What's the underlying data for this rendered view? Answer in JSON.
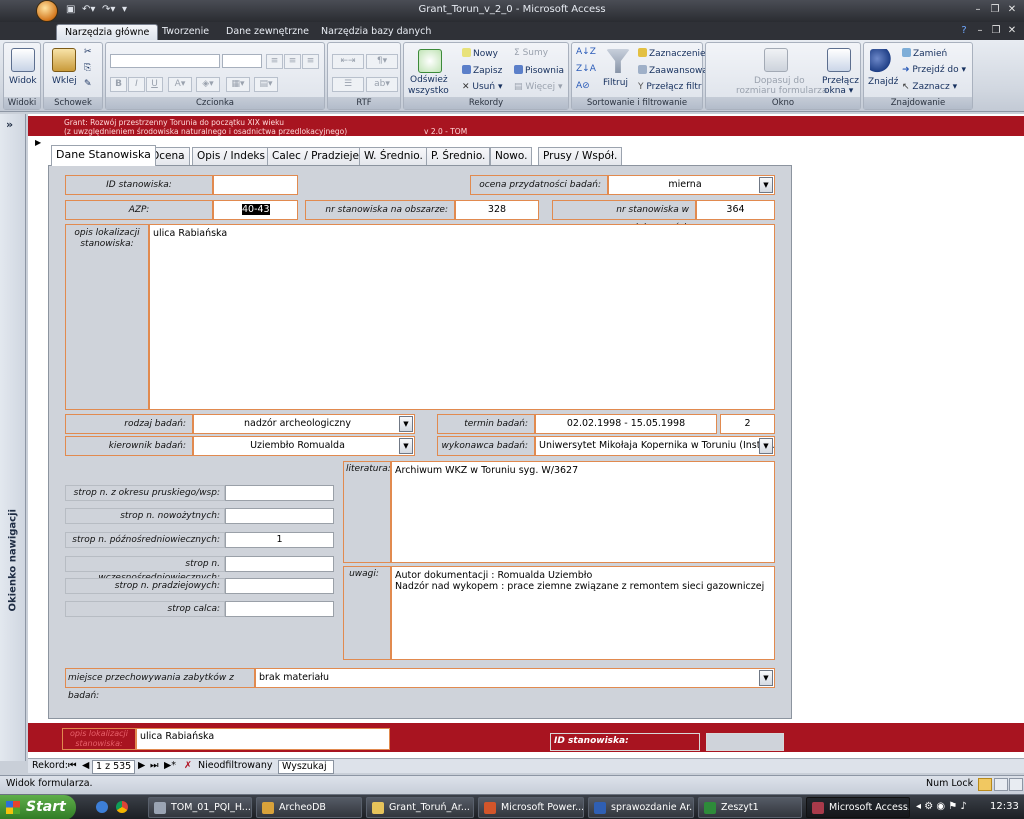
{
  "window": {
    "title": "Grant_Torun_v_2_0 - Microsoft Access"
  },
  "ribbon_tabs": [
    "Narzędzia główne",
    "Tworzenie",
    "Dane zewnętrzne",
    "Narzędzia bazy danych"
  ],
  "ribbon": {
    "widok": "Widok",
    "wklej": "Wklej",
    "groups": {
      "widoki": "Widoki",
      "schowek": "Schowek",
      "czcionka": "Czcionka",
      "rtf": "RTF",
      "rekordy": "Rekordy",
      "sort": "Sortowanie i filtrowanie",
      "okno": "Okno",
      "znajdowanie": "Znajdowanie"
    },
    "odswiez": "Odśwież",
    "wszystko": "wszystko",
    "nowy": "Nowy",
    "zapisz": "Zapisz",
    "usun": "Usuń",
    "sumy": "Sumy",
    "pisownia": "Pisownia",
    "wiecej": "Więcej",
    "filtruj": "Filtruj",
    "zaznaczenie": "Zaznaczenie",
    "zaawansowane": "Zaawansowane",
    "przelacz_filtr": "Przełącz filtr",
    "dopasuj1": "Dopasuj do",
    "dopasuj2": "rozmiaru formularza",
    "przelacz1": "Przełącz",
    "przelacz2": "okna",
    "znajdz": "Znajdź",
    "zamien": "Zamień",
    "przejdz": "Przejdź do",
    "zaznacz": "Zaznacz"
  },
  "nav_pane": {
    "title": "Okienko nawigacji"
  },
  "header": {
    "line1": "Grant: Rozwój przestrzenny Torunia do początku XIX wieku",
    "line2": "(z uwzględnieniem środowiska naturalnego i osadnictwa przedlokacyjnego)",
    "version": "v 2.0 - TOM"
  },
  "form_tabs": [
    "Dane Stanowiska",
    "Ocena",
    "Opis / Indeks",
    "Calec / Pradzieje",
    "W. Średnio.",
    "P. Średnio.",
    "Nowo.",
    "Prusy / Współ."
  ],
  "fields": {
    "id_label": "ID stanowiska:",
    "id_value": "",
    "ocena_label": "ocena przydatności badań:",
    "ocena_value": "mierna",
    "azp_label": "AZP:",
    "azp_value": "40-43",
    "nr_obszar_label": "nr stanowiska na obszarze:",
    "nr_obszar_value": "328",
    "nr_miejsc_label": "nr stanowiska w miejscowości:",
    "nr_miejsc_value": "364",
    "opis_label": "opis lokalizacji stanowiska:",
    "opis_value": "ulica Rabiańska",
    "rodzaj_label": "rodzaj badań:",
    "rodzaj_value": "nadzór archeologiczny",
    "termin_label": "termin badań:",
    "termin_value": "02.02.1998 - 15.05.1998",
    "termin_num": "2",
    "kierownik_label": "kierownik badań:",
    "kierownik_value": "Uziembło Romualda",
    "wykonawca_label": "wykonawca badań:",
    "wykonawca_value": "Uniwersytet Mikołaja Kopernika w Toruniu (Instytut",
    "literatura_label": "literatura:",
    "literatura_value": "Archiwum WKZ w Toruniu syg. W/3627",
    "uwagi_label": "uwagi:",
    "uwagi_value": "Autor dokumentacji : Romualda Uziembło\nNadzór nad wykopem : prace ziemne związane z remontem sieci gazowniczej",
    "miejsce_label": "miejsce przechowywania zabytków z badań:",
    "miejsce_value": "brak materiału"
  },
  "strop": [
    {
      "label": "strop n. z okresu pruskiego/wsp:",
      "value": ""
    },
    {
      "label": "strop n. nowożytnych:",
      "value": ""
    },
    {
      "label": "strop n. późnośredniowiecznych:",
      "value": "1"
    },
    {
      "label": "strop n. wczesnośredniowiecznych:",
      "value": ""
    },
    {
      "label": "strop n. pradziejowych:",
      "value": ""
    },
    {
      "label": "strop calca:",
      "value": ""
    }
  ],
  "footer": {
    "opis_label": "opis lokalizacji stanowiska:",
    "opis_value": "ulica Rabiańska",
    "id_label": "ID stanowiska:",
    "id_value": ""
  },
  "record_nav": {
    "label": "Rekord:",
    "position": "1 z 535",
    "filter": "Nieodfiltrowany",
    "search": "Wyszukaj"
  },
  "status": {
    "text": "Widok formularza.",
    "numlock": "Num Lock"
  },
  "taskbar": {
    "start": "Start",
    "items": [
      "TOM_01_PQI_H...",
      "ArcheoDB",
      "Grant_Toruń_Ar...",
      "Microsoft Power...",
      "sprawozdanie Ar...",
      "Zeszyt1",
      "Microsoft Access..."
    ],
    "clock": "12:33"
  },
  "colors": {
    "accent_red": "#a81420",
    "field_border": "#e18a4f",
    "office_orange": "#d4781e"
  }
}
